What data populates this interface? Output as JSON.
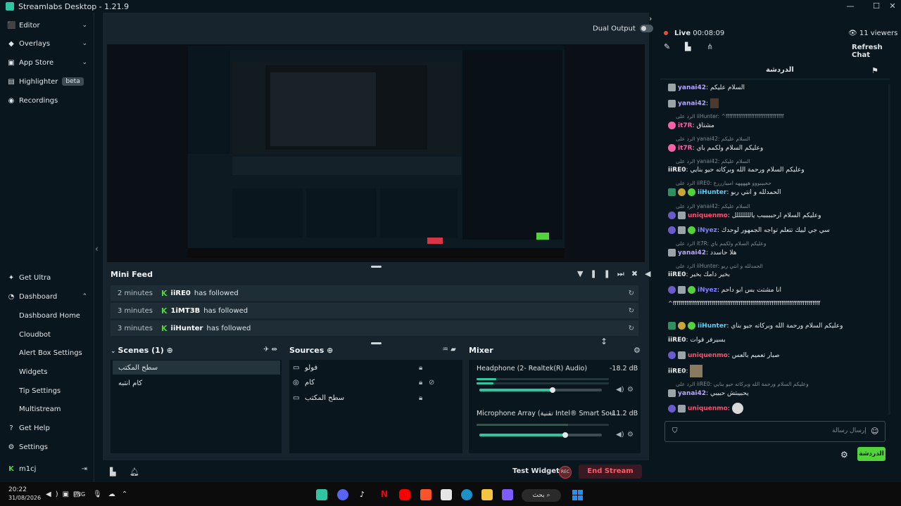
{
  "app": {
    "title": "Streamlabs Desktop - 1.21.9"
  },
  "sidebar": {
    "top": [
      {
        "label": "Editor",
        "icon": "editor-icon"
      },
      {
        "label": "Overlays",
        "icon": "overlays-icon"
      },
      {
        "label": "App Store",
        "icon": "store-icon"
      },
      {
        "label": "Highlighter",
        "badge": "beta",
        "icon": "highlighter-icon"
      },
      {
        "label": "Recordings",
        "icon": "recordings-icon"
      }
    ],
    "get_ultra": "Get Ultra",
    "dashboard": "Dashboard",
    "dash_items": [
      "Dashboard Home",
      "Cloudbot",
      "Alert Box Settings",
      "Widgets",
      "Tip Settings",
      "Multistream"
    ],
    "get_help": "Get Help",
    "settings": "Settings",
    "user": "m1cj"
  },
  "editor": {
    "dual_output": "Dual Output",
    "mini_feed": {
      "title": "Mini Feed",
      "rows": [
        {
          "time": "2 minutes",
          "user": "iiRE0",
          "action": "has followed"
        },
        {
          "time": "3 minutes",
          "user": "1iMT3B",
          "action": "has followed"
        },
        {
          "time": "3 minutes",
          "user": "iiHunter",
          "action": "has followed"
        }
      ]
    },
    "scenes": {
      "title": "Scenes (1)",
      "items": [
        "سطح المكتب",
        "كام انتبه"
      ]
    },
    "sources": {
      "title": "Sources",
      "items": [
        "فولو",
        "كام",
        "سطح المكتب"
      ]
    },
    "mixer": {
      "title": "Mixer",
      "channels": [
        {
          "name": "Headphone (2- Realtek(R) Audio)",
          "db": "-18.2 dB",
          "level": 0.6
        },
        {
          "name": "Microphone Array (تقنية Intel® Smart Sou...",
          "db": "-11.2 dB",
          "level": 0.7
        }
      ]
    },
    "test_widgets": "Test Widgets",
    "end_stream": "End Stream"
  },
  "stream": {
    "live_label": "Live",
    "time": "00:08:09",
    "viewers": "11 viewers",
    "refresh": "Refresh Chat"
  },
  "chat": {
    "title": "الدردشة",
    "input_placeholder": "إرسال رسالة",
    "send": "الدردشة",
    "messages": [
      {
        "user": "yanai42",
        "text": "السلام عليكم",
        "color": "#b9a7ff"
      },
      {
        "user": "yanai42",
        "text": "",
        "color": "#b9a7ff"
      },
      {
        "reply": "الرد على iiHunter: ^ffffffffffffffffffffffffffffffff"
      },
      {
        "user": "it7R",
        "text": "مشتاق",
        "color": "#ff5fa8"
      },
      {
        "reply": "الرد على yanai42: السلام عليكم"
      },
      {
        "user": "it7R",
        "text": "وعليكم السلام ولكمم باي",
        "color": "#ff5fa8"
      },
      {
        "reply": "الرد على yanai42: السلام عليكم"
      },
      {
        "user": "iiRE0",
        "text": "وعليكم السلام ورحمة الله وبركاته حيو بنايي",
        "color": "#ffffff"
      },
      {
        "reply": "الرد على iiRE0: ححبيبووو هههههه امبيارررع"
      },
      {
        "user": "iiHunter",
        "text": "الحمدلله و انتي ربو",
        "color": "#4fd4ff"
      },
      {
        "reply": "الرد على yanai42: السلام عليكم"
      },
      {
        "user": "uniquenmo",
        "text": "وعليكم السلام ارحبببببب يالللللللل",
        "color": "#ff4f6f"
      },
      {
        "user": "iNyez",
        "text": "سي جي لبيك تتعلم تواجه الجمهور لوحدك",
        "color": "#7f7fff"
      },
      {
        "reply": "الرد على it7R: وعليكم السلام ولكمم باي"
      },
      {
        "user": "yanai42",
        "text": "هلا حاسدد",
        "color": "#b9a7ff"
      },
      {
        "reply": "الرد على iiHunter: الحمدلله و انتي ربو"
      },
      {
        "user": "iiRE0",
        "text": "بخير دامك بخير",
        "color": "#ffffff"
      },
      {
        "user": "iNyez",
        "text": "انا مشتت بس ابو داحم",
        "color": "#7f7fff"
      },
      {
        "user": "",
        "text": "^ffffffffffffffffffffffffffffffffffffffffffffffffffffffffffffffffffffffffffff",
        "color": "#ffffff"
      },
      {
        "user": "iiHunter",
        "text": "وعليكم السلام ورحمة الله وبركاته جيو بناي",
        "color": "#4fd4ff"
      },
      {
        "user": "iiRE0",
        "text": "بسيرفر قوات",
        "color": "#ffffff"
      },
      {
        "user": "uniquenmo",
        "text": "صبار تعميم بالعس",
        "color": "#ff4f6f"
      },
      {
        "user": "iiRE0",
        "text": "",
        "color": "#ffffff"
      },
      {
        "reply": "الرد على iiRE0: وعليكم السلام ورحمة الله وبركاته حيو بنايي"
      },
      {
        "user": "yanai42",
        "text": "يحبيبتش حبيبي",
        "color": "#b9a7ff"
      },
      {
        "user": "uniquenmo",
        "text": "",
        "color": "#ff4f6f"
      }
    ]
  },
  "taskbar": {
    "time": "20:22",
    "date": "31/08/2026",
    "lang": "ENG",
    "search": "بحث"
  },
  "colors": {
    "accent": "#31c3a2",
    "live": "#e74c3c",
    "end": "#d63646",
    "chat_send": "#53d33b"
  }
}
